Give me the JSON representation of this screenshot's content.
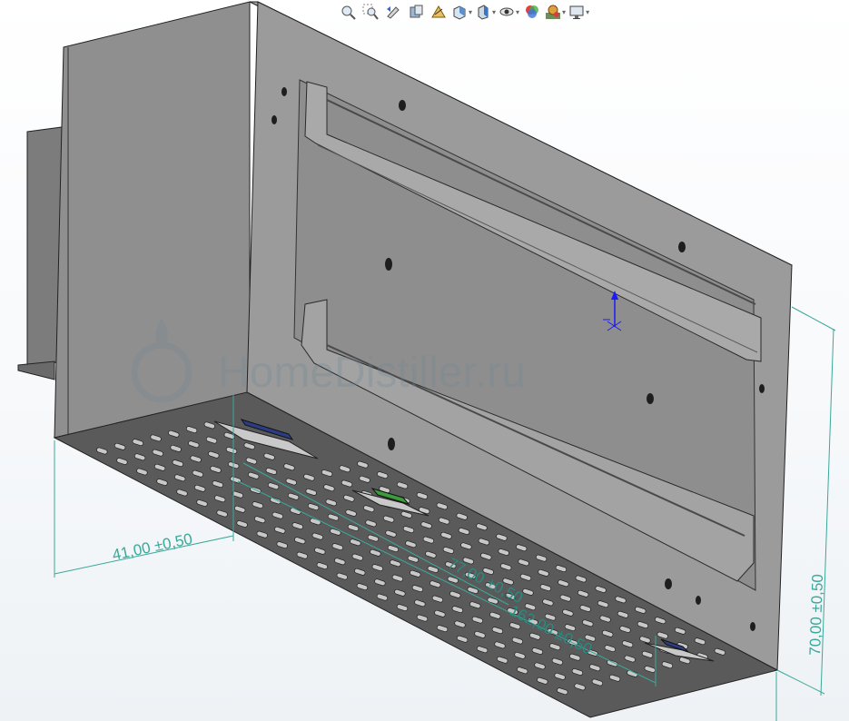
{
  "toolbar": {
    "items": [
      {
        "name": "zoom-to-fit-icon",
        "has_dropdown": false
      },
      {
        "name": "zoom-to-area-icon",
        "has_dropdown": false
      },
      {
        "name": "previous-view-icon",
        "has_dropdown": false
      },
      {
        "name": "section-view-icon",
        "has_dropdown": false
      },
      {
        "name": "dynamic-annotation-icon",
        "has_dropdown": false
      },
      {
        "name": "view-orientation-icon",
        "has_dropdown": true
      },
      {
        "name": "display-style-icon",
        "has_dropdown": true
      },
      {
        "name": "hide-show-items-icon",
        "has_dropdown": true
      },
      {
        "name": "edit-appearance-icon",
        "has_dropdown": false
      },
      {
        "name": "apply-scene-icon",
        "has_dropdown": true
      },
      {
        "name": "view-settings-icon",
        "has_dropdown": true
      }
    ],
    "caret": "▾"
  },
  "dimensions": {
    "depth": "41,00 ±0,50",
    "height": "70,00 ±0,50",
    "offset_short": "77,00 ±0,50",
    "length": "162,00 ±0,50"
  },
  "watermark": "HomeDistiller.ru",
  "colors": {
    "model_gray": "#8c8c8c",
    "dimension_teal": "#3aa89a",
    "triad_blue": "#1a1aff",
    "led_blue": "#2b3c82",
    "led_green": "#3c9c3c"
  }
}
